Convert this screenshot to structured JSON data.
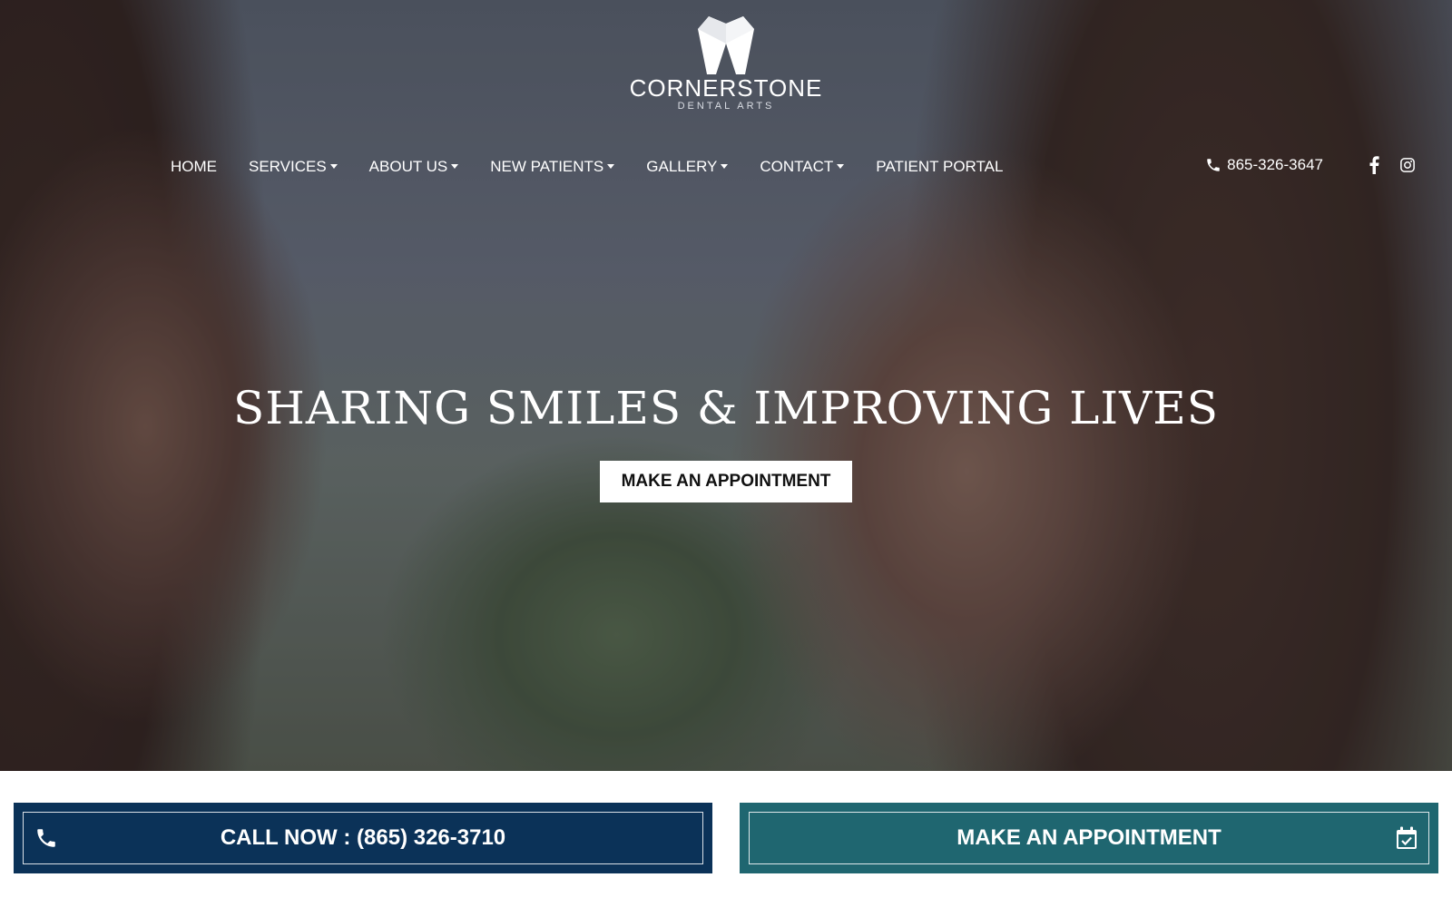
{
  "brand": {
    "name": "CORNERSTONE",
    "tagline": "DENTAL ARTS"
  },
  "nav": {
    "items": [
      {
        "label": "HOME",
        "dropdown": false
      },
      {
        "label": "SERVICES",
        "dropdown": true
      },
      {
        "label": "ABOUT US",
        "dropdown": true
      },
      {
        "label": "NEW PATIENTS",
        "dropdown": true
      },
      {
        "label": "GALLERY",
        "dropdown": true
      },
      {
        "label": "CONTACT",
        "dropdown": true
      },
      {
        "label": "PATIENT PORTAL",
        "dropdown": false
      }
    ]
  },
  "header_contact": {
    "phone": "865-326-3647",
    "phone_icon": "phone-icon",
    "social": [
      "facebook-icon",
      "instagram-icon"
    ]
  },
  "hero": {
    "headline": "SHARING SMILES & IMPROVING LIVES",
    "cta_label": "MAKE AN APPOINTMENT"
  },
  "bottom_bar": {
    "call_label": "CALL NOW : (865) 326-3710",
    "call_icon": "phone-icon",
    "appointment_label": "MAKE AN APPOINTMENT",
    "appointment_icon": "calendar-check-icon"
  },
  "colors": {
    "call_button": "#0b3258",
    "appointment_button": "#1f6670",
    "hero_cta_bg": "#ffffff",
    "text_light": "#ffffff"
  }
}
